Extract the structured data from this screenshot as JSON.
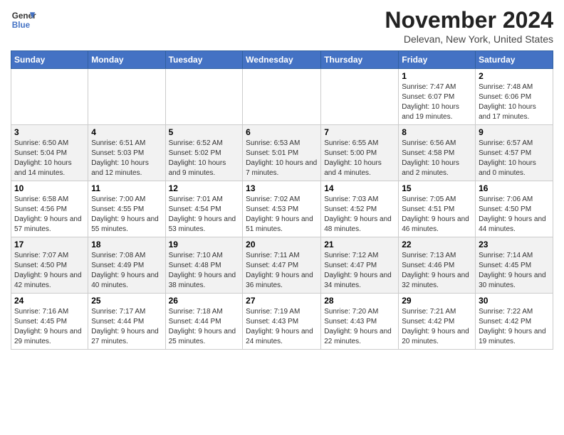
{
  "logo": {
    "line1": "General",
    "line2": "Blue"
  },
  "title": "November 2024",
  "location": "Delevan, New York, United States",
  "weekdays": [
    "Sunday",
    "Monday",
    "Tuesday",
    "Wednesday",
    "Thursday",
    "Friday",
    "Saturday"
  ],
  "weeks": [
    [
      {
        "day": "",
        "info": ""
      },
      {
        "day": "",
        "info": ""
      },
      {
        "day": "",
        "info": ""
      },
      {
        "day": "",
        "info": ""
      },
      {
        "day": "",
        "info": ""
      },
      {
        "day": "1",
        "info": "Sunrise: 7:47 AM\nSunset: 6:07 PM\nDaylight: 10 hours and 19 minutes."
      },
      {
        "day": "2",
        "info": "Sunrise: 7:48 AM\nSunset: 6:06 PM\nDaylight: 10 hours and 17 minutes."
      }
    ],
    [
      {
        "day": "3",
        "info": "Sunrise: 6:50 AM\nSunset: 5:04 PM\nDaylight: 10 hours and 14 minutes."
      },
      {
        "day": "4",
        "info": "Sunrise: 6:51 AM\nSunset: 5:03 PM\nDaylight: 10 hours and 12 minutes."
      },
      {
        "day": "5",
        "info": "Sunrise: 6:52 AM\nSunset: 5:02 PM\nDaylight: 10 hours and 9 minutes."
      },
      {
        "day": "6",
        "info": "Sunrise: 6:53 AM\nSunset: 5:01 PM\nDaylight: 10 hours and 7 minutes."
      },
      {
        "day": "7",
        "info": "Sunrise: 6:55 AM\nSunset: 5:00 PM\nDaylight: 10 hours and 4 minutes."
      },
      {
        "day": "8",
        "info": "Sunrise: 6:56 AM\nSunset: 4:58 PM\nDaylight: 10 hours and 2 minutes."
      },
      {
        "day": "9",
        "info": "Sunrise: 6:57 AM\nSunset: 4:57 PM\nDaylight: 10 hours and 0 minutes."
      }
    ],
    [
      {
        "day": "10",
        "info": "Sunrise: 6:58 AM\nSunset: 4:56 PM\nDaylight: 9 hours and 57 minutes."
      },
      {
        "day": "11",
        "info": "Sunrise: 7:00 AM\nSunset: 4:55 PM\nDaylight: 9 hours and 55 minutes."
      },
      {
        "day": "12",
        "info": "Sunrise: 7:01 AM\nSunset: 4:54 PM\nDaylight: 9 hours and 53 minutes."
      },
      {
        "day": "13",
        "info": "Sunrise: 7:02 AM\nSunset: 4:53 PM\nDaylight: 9 hours and 51 minutes."
      },
      {
        "day": "14",
        "info": "Sunrise: 7:03 AM\nSunset: 4:52 PM\nDaylight: 9 hours and 48 minutes."
      },
      {
        "day": "15",
        "info": "Sunrise: 7:05 AM\nSunset: 4:51 PM\nDaylight: 9 hours and 46 minutes."
      },
      {
        "day": "16",
        "info": "Sunrise: 7:06 AM\nSunset: 4:50 PM\nDaylight: 9 hours and 44 minutes."
      }
    ],
    [
      {
        "day": "17",
        "info": "Sunrise: 7:07 AM\nSunset: 4:50 PM\nDaylight: 9 hours and 42 minutes."
      },
      {
        "day": "18",
        "info": "Sunrise: 7:08 AM\nSunset: 4:49 PM\nDaylight: 9 hours and 40 minutes."
      },
      {
        "day": "19",
        "info": "Sunrise: 7:10 AM\nSunset: 4:48 PM\nDaylight: 9 hours and 38 minutes."
      },
      {
        "day": "20",
        "info": "Sunrise: 7:11 AM\nSunset: 4:47 PM\nDaylight: 9 hours and 36 minutes."
      },
      {
        "day": "21",
        "info": "Sunrise: 7:12 AM\nSunset: 4:47 PM\nDaylight: 9 hours and 34 minutes."
      },
      {
        "day": "22",
        "info": "Sunrise: 7:13 AM\nSunset: 4:46 PM\nDaylight: 9 hours and 32 minutes."
      },
      {
        "day": "23",
        "info": "Sunrise: 7:14 AM\nSunset: 4:45 PM\nDaylight: 9 hours and 30 minutes."
      }
    ],
    [
      {
        "day": "24",
        "info": "Sunrise: 7:16 AM\nSunset: 4:45 PM\nDaylight: 9 hours and 29 minutes."
      },
      {
        "day": "25",
        "info": "Sunrise: 7:17 AM\nSunset: 4:44 PM\nDaylight: 9 hours and 27 minutes."
      },
      {
        "day": "26",
        "info": "Sunrise: 7:18 AM\nSunset: 4:44 PM\nDaylight: 9 hours and 25 minutes."
      },
      {
        "day": "27",
        "info": "Sunrise: 7:19 AM\nSunset: 4:43 PM\nDaylight: 9 hours and 24 minutes."
      },
      {
        "day": "28",
        "info": "Sunrise: 7:20 AM\nSunset: 4:43 PM\nDaylight: 9 hours and 22 minutes."
      },
      {
        "day": "29",
        "info": "Sunrise: 7:21 AM\nSunset: 4:42 PM\nDaylight: 9 hours and 20 minutes."
      },
      {
        "day": "30",
        "info": "Sunrise: 7:22 AM\nSunset: 4:42 PM\nDaylight: 9 hours and 19 minutes."
      }
    ]
  ]
}
